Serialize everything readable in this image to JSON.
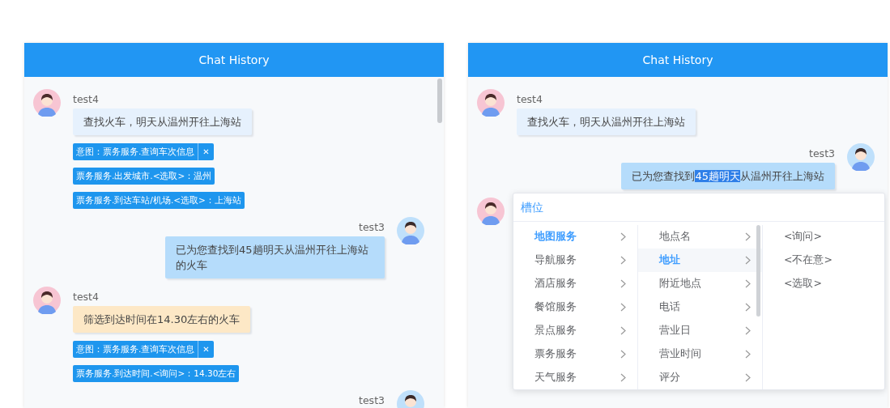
{
  "panels": [
    {
      "title": "Chat History",
      "messages": [
        {
          "kind": "received",
          "user": "test4",
          "color": "#e6f1fd",
          "text": [
            {
              "text": "查找火车，明天从温州开往上海站",
              "selected": false
            }
          ],
          "tags": [
            {
              "kind": "intent",
              "label": "意图：票务服务.查询车次信息",
              "close": "✕"
            },
            {
              "kind": "slot",
              "label": "票务服务.出发城市.<选取>：温州"
            },
            {
              "kind": "slot",
              "label": "票务服务.到达车站/机场.<选取>：上海站"
            }
          ]
        },
        {
          "kind": "sent",
          "user": "test3",
          "color": "#b5dcfb",
          "text": [
            {
              "text": "已为您查找到45趟明天从温州开往上海站的火车",
              "selected": false
            }
          ]
        },
        {
          "kind": "received",
          "user": "test4",
          "color": "#fde8c6",
          "text": [
            {
              "text": "筛选到达时间在14.30左右的火车",
              "selected": false
            }
          ],
          "tags": [
            {
              "kind": "intent",
              "label": "意图：票务服务.查询车次信息",
              "close": "✕"
            },
            {
              "kind": "slot",
              "label": "票务服务.到达时间.<询问>：14.30左右"
            }
          ]
        },
        {
          "kind": "sent",
          "user": "test3"
        }
      ]
    },
    {
      "title": "Chat History",
      "messages": [
        {
          "kind": "received",
          "user": "test4",
          "color": "#e6f1fd",
          "text": [
            {
              "text": "查找火车，明天从温州开往上海站",
              "selected": false
            }
          ]
        },
        {
          "kind": "sent",
          "user": "test3",
          "color": "#b5dcfb",
          "text": [
            {
              "text": "已为您查找到",
              "selected": false
            },
            {
              "text": "45趟明天",
              "selected": true
            },
            {
              "text": "从温州开往上海站",
              "selected": false
            }
          ]
        },
        {
          "kind": "received"
        }
      ],
      "popup": {
        "title": "槽位",
        "columns": [
          {
            "items": [
              {
                "label": "地图服务",
                "selected": true,
                "expandable": true
              },
              {
                "label": "导航服务",
                "selected": false,
                "expandable": true
              },
              {
                "label": "酒店服务",
                "selected": false,
                "expandable": true
              },
              {
                "label": "餐馆服务",
                "selected": false,
                "expandable": true
              },
              {
                "label": "景点服务",
                "selected": false,
                "expandable": true
              },
              {
                "label": "票务服务",
                "selected": false,
                "expandable": true
              },
              {
                "label": "天气服务",
                "selected": false,
                "expandable": true
              }
            ]
          },
          {
            "items": [
              {
                "label": "地点名",
                "selected": false,
                "expandable": true
              },
              {
                "label": "地址",
                "selected": true,
                "expandable": true
              },
              {
                "label": "附近地点",
                "selected": false,
                "expandable": true
              },
              {
                "label": "电话",
                "selected": false,
                "expandable": true
              },
              {
                "label": "营业日",
                "selected": false,
                "expandable": true
              },
              {
                "label": "营业时间",
                "selected": false,
                "expandable": true
              },
              {
                "label": "评分",
                "selected": false,
                "expandable": true
              }
            ]
          },
          {
            "items": [
              {
                "label": "<询问>",
                "selected": false,
                "expandable": false
              },
              {
                "label": "<不在意>",
                "selected": false,
                "expandable": false
              },
              {
                "label": "<选取>",
                "selected": false,
                "expandable": false
              }
            ]
          }
        ]
      }
    }
  ]
}
